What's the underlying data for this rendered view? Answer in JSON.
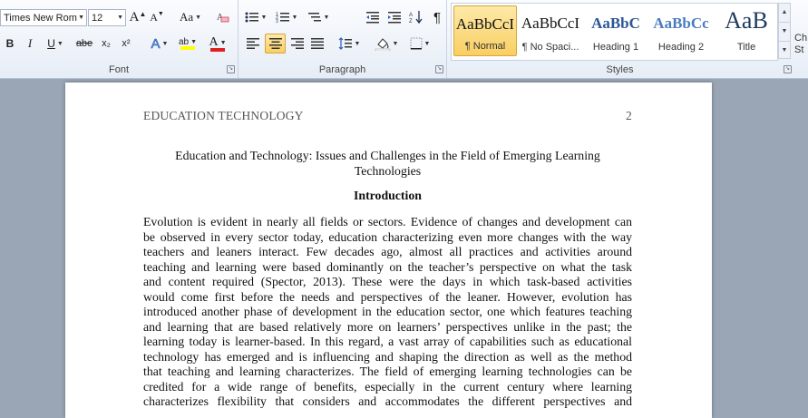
{
  "ribbon": {
    "font": {
      "name": "Times New Rom",
      "size": "12",
      "group_label": "Font",
      "grow": "A",
      "shrink": "A",
      "change_case": "Aa",
      "bold": "B",
      "italic": "I",
      "underline": "U",
      "strikethrough": "abe",
      "subscript": "x₂",
      "superscript": "x²",
      "text_effects": "A",
      "highlight": "ab",
      "font_color": "A"
    },
    "paragraph": {
      "group_label": "Paragraph",
      "show_marks": "¶"
    },
    "styles": {
      "group_label": "Styles",
      "items": [
        {
          "sample": "AaBbCcI",
          "name": "¶ Normal"
        },
        {
          "sample": "AaBbCcI",
          "name": "¶ No Spaci..."
        },
        {
          "sample": "AaBbC",
          "name": "Heading 1"
        },
        {
          "sample": "AaBbCc",
          "name": "Heading 2"
        },
        {
          "sample": "AaB",
          "name": "Title"
        }
      ],
      "change_styles": "Ch St"
    }
  },
  "document": {
    "header_left": "EDUCATION TECHNOLOGY",
    "page_number": "2",
    "title_line1": "Education and Technology: Issues and Challenges in the Field of Emerging Learning",
    "title_line2": "Technologies",
    "heading": "Introduction",
    "body_lines": [
      "Evolution is evident in nearly all fields or sectors. Evidence of changes and development can",
      "be observed in every sector today, education characterizing even more changes with the way",
      "teachers and leaners interact. Few decades ago, almost all practices and activities around",
      "teaching and learning were based dominantly on the teacher’s perspective on what the task",
      "and content required (Spector, 2013). These were the days in which task-based activities",
      "would come first before the needs and perspectives of the leaner. However, evolution has",
      "introduced another phase of development in the education sector, one which features teaching",
      "and learning that are based relatively more on learners’ perspectives unlike in the past; the",
      "learning today is learner-based. In this regard, a vast array of capabilities such as educational",
      "technology has emerged and is influencing and shaping the direction as well as the method",
      "that teaching and learning characterizes. The field of emerging learning technologies can be",
      "credited for a wide range of benefits, especially in the current century where learning",
      "characterizes flexibility that considers and accommodates the different perspectives and"
    ]
  }
}
